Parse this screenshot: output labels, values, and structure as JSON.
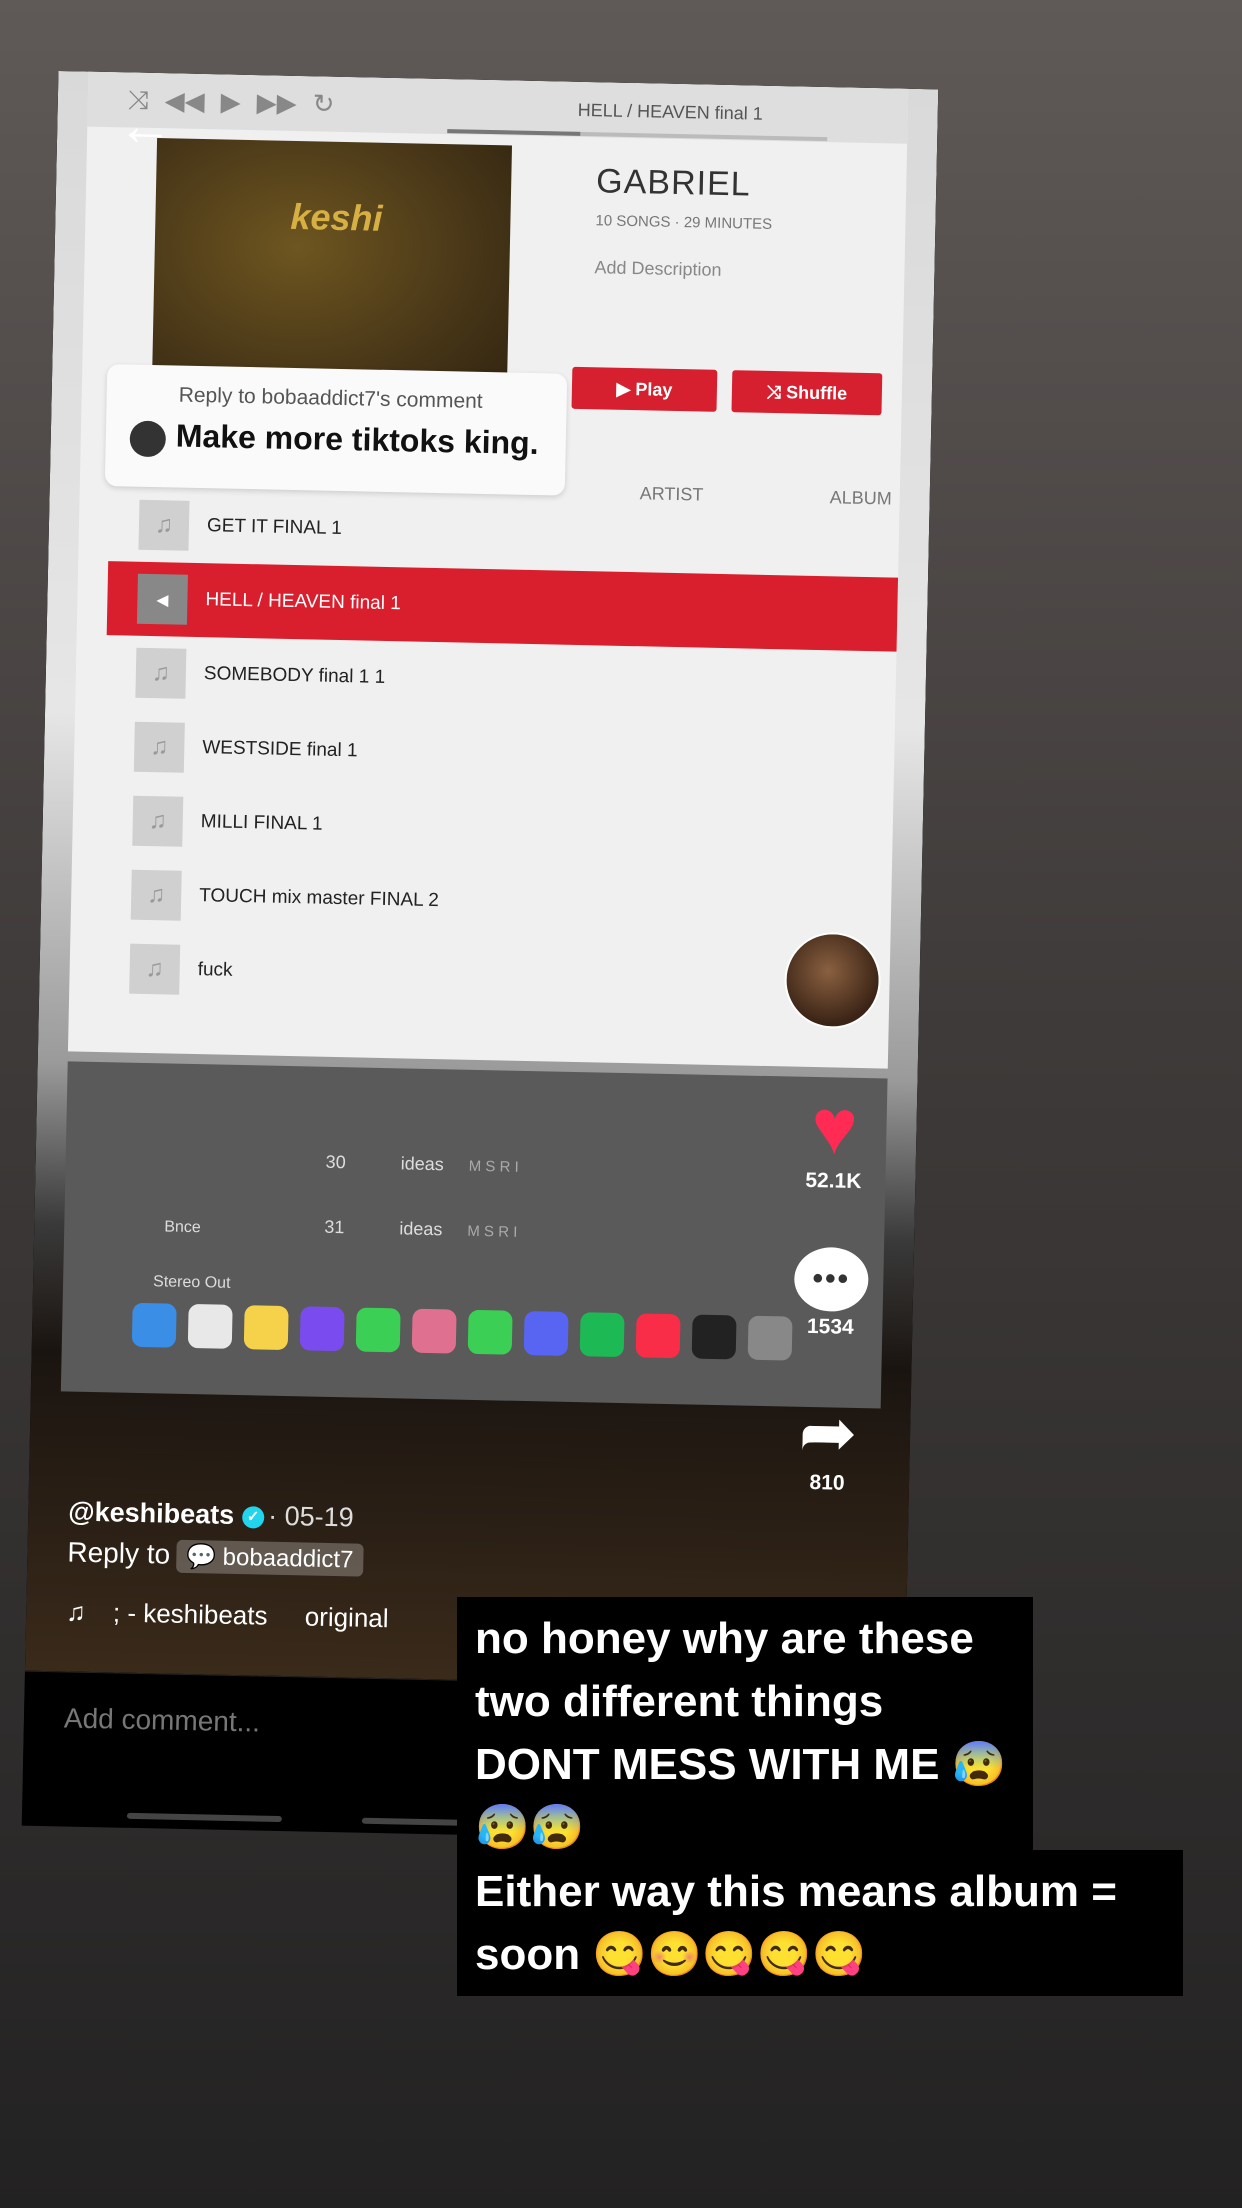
{
  "video": {
    "now_playing": "HELL / HEAVEN final 1",
    "album_art_text": "keshi",
    "playlist_title": "GABRIEL",
    "playlist_meta": "10 SONGS · 29 MINUTES",
    "add_description": "Add Description",
    "play_label": "▶ Play",
    "shuffle_label": "⤨ Shuffle",
    "col_artist": "ARTIST",
    "col_album": "ALBUM",
    "songs": [
      "GET IT FINAL 1",
      "HELL / HEAVEN final 1",
      "SOMEBODY final 1 1",
      "WESTSIDE final 1",
      "MILLI FINAL 1",
      "TOUCH mix master FINAL 2",
      "fuck"
    ],
    "daw": {
      "track_30": "30",
      "track_31": "31",
      "track_name_30": "ideas",
      "track_name_31": "ideas",
      "bnce": "Bnce",
      "stereo_out": "Stereo Out",
      "msri": "M S R I"
    }
  },
  "reply_card": {
    "small": "Reply to bobaaddict7's comment",
    "big": "Make more tiktoks king."
  },
  "rail": {
    "likes": "52.1K",
    "comments": "1534",
    "shares": "810",
    "comment_icon_text": "•••"
  },
  "meta": {
    "handle": "@keshibeats",
    "verified_icon": "✓",
    "date": "· 05-19",
    "reply_to": "Reply to",
    "reply_chip": "bobaaddict7",
    "sound": "; - keshibeats",
    "original": "original"
  },
  "comment_placeholder": "Add comment...",
  "captions": {
    "first": "no honey why are these two different things DONT MESS WITH ME 😰😰😰",
    "second": "Either way this means album = soon 😋😊😋😋😋"
  }
}
